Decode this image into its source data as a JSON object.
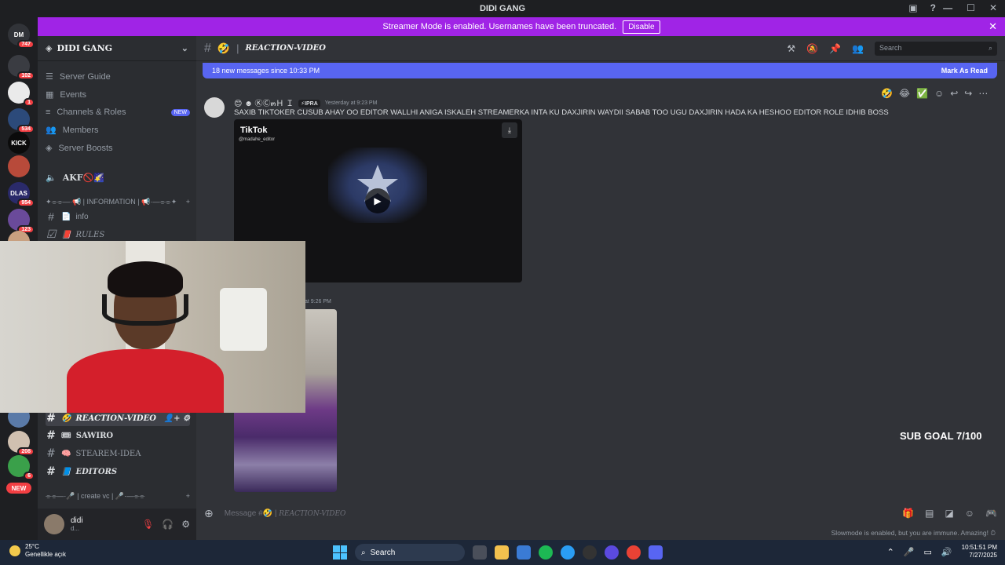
{
  "window": {
    "title": "DIDI GANG",
    "controls": [
      "—",
      "☐",
      "✕"
    ],
    "top_icons": [
      "▣",
      "?"
    ]
  },
  "streamer_bar": {
    "text": "Streamer Mode is enabled. Usernames have been truncated.",
    "button": "Disable",
    "close": "✕"
  },
  "servers": [
    {
      "name": "DM",
      "badge": "747",
      "color": "#313338"
    },
    {
      "name": "",
      "badge": "102",
      "color": "#3a3c42"
    },
    {
      "name": "",
      "badge": "1",
      "color": "#eaeaea"
    },
    {
      "name": "",
      "badge": "534",
      "color": "#2c4a7a"
    },
    {
      "name": "KICK",
      "badge": "",
      "color": "#0b0b0b"
    },
    {
      "name": "",
      "badge": "",
      "color": "#b84a3a"
    },
    {
      "name": "DLAS",
      "badge": "954",
      "color": "#2a2a6a"
    },
    {
      "name": "",
      "badge": "123",
      "color": "#6a4a9a"
    },
    {
      "name": "",
      "badge": "351",
      "color": "#c8a080"
    },
    {
      "name": "",
      "badge": "",
      "color": "#5a7aa8"
    },
    {
      "name": "",
      "badge": "208",
      "color": "#d0c0b0"
    },
    {
      "name": "",
      "badge": "6",
      "color": "#3aa04a"
    },
    {
      "name": "NEW",
      "badge": "",
      "color": "#f23f43"
    }
  ],
  "sidebar": {
    "server_name": "DIDI GANG",
    "nav": [
      {
        "icon": "☰",
        "label": "Server Guide"
      },
      {
        "icon": "▦",
        "label": "Events"
      },
      {
        "icon": "≡",
        "label": "Channels & Roles",
        "badge": "NEW"
      },
      {
        "icon": "👥",
        "label": "Members"
      },
      {
        "icon": "◈",
        "label": "Server Boosts"
      }
    ],
    "voice_channel": "AKF🚫🌠",
    "category1": "✦⌯⌯—·📢 | INFORMATION | 📢·—⌯⌯✦",
    "channels_top": [
      {
        "icon": "📄",
        "label": "info",
        "serif": false
      },
      {
        "icon": "📕",
        "label": "RULES",
        "serif": true
      }
    ],
    "channels_bottom": [
      {
        "icon": "🤣",
        "label": "REACTION-VIDEO",
        "active": true
      },
      {
        "icon": "🎟",
        "label": "SAWIRO",
        "active": false
      },
      {
        "icon": "🧠",
        "label": "STEAREM-IDEA",
        "active": false
      },
      {
        "icon": "📘",
        "label": "EDITORS",
        "active": false
      }
    ],
    "category2": "⌯⌯—·🎤 | create vc | 🎤·—⌯⌯",
    "user": {
      "name": "didi",
      "status": "d..."
    }
  },
  "main": {
    "channel_title": "REACTION-VIDEO",
    "channel_icon": "🤣",
    "search_placeholder": "Search",
    "new_messages": "18 new messages since 10:33 PM",
    "mark_as_read": "Mark As Read",
    "msg1": {
      "author": "😊 ☻ ⓀⒸ๓Ｈ Ｉ",
      "tag": "⚡IPRA",
      "timestamp": "Yesterday at 9:23 PM",
      "text": "SAXIB TIKTOKER CUSUB AHAY OO EDITOR WALLHI ANIGA ISKALEH STREAMERKA INTA KU DAXJIRIN WAYDII SABAB TOO UGU DAXJIRIN HADA KA HESHOO EDITOR ROLE IDHIB BOSS",
      "embed": {
        "brand": "TikTok",
        "user": "@madahe_editor"
      }
    },
    "msg2": {
      "timestamp": "at 9:26 PM"
    },
    "overlay_text": "SUB GOAL 7/100",
    "composer_placeholder": "Message #🤣 | ",
    "composer_channel": "REACTION-VIDEO",
    "slowmode": "Slowmode is enabled, but you are immune. Amazing!"
  },
  "taskbar": {
    "temp": "25°C",
    "weather": "Genellikle açık",
    "search": "Search",
    "time": "10:51:51 PM",
    "date": "7/27/2025"
  }
}
